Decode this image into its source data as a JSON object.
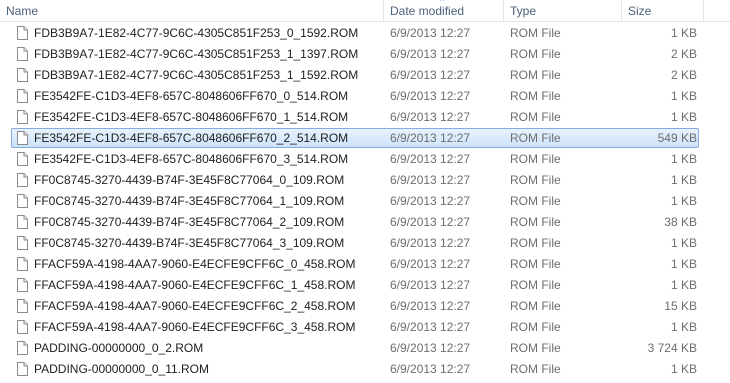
{
  "columns": {
    "name": "Name",
    "date": "Date modified",
    "type": "Type",
    "size": "Size"
  },
  "sort_arrow": "^",
  "rows": [
    {
      "name": "FDB3B9A7-1E82-4C77-9C6C-4305C851F253_0_1592.ROM",
      "date": "6/9/2013 12:27",
      "type": "ROM File",
      "size": "1 KB",
      "selected": false
    },
    {
      "name": "FDB3B9A7-1E82-4C77-9C6C-4305C851F253_1_1397.ROM",
      "date": "6/9/2013 12:27",
      "type": "ROM File",
      "size": "2 KB",
      "selected": false
    },
    {
      "name": "FDB3B9A7-1E82-4C77-9C6C-4305C851F253_1_1592.ROM",
      "date": "6/9/2013 12:27",
      "type": "ROM File",
      "size": "2 KB",
      "selected": false
    },
    {
      "name": "FE3542FE-C1D3-4EF8-657C-8048606FF670_0_514.ROM",
      "date": "6/9/2013 12:27",
      "type": "ROM File",
      "size": "1 KB",
      "selected": false
    },
    {
      "name": "FE3542FE-C1D3-4EF8-657C-8048606FF670_1_514.ROM",
      "date": "6/9/2013 12:27",
      "type": "ROM File",
      "size": "1 KB",
      "selected": false
    },
    {
      "name": "FE3542FE-C1D3-4EF8-657C-8048606FF670_2_514.ROM",
      "date": "6/9/2013 12:27",
      "type": "ROM File",
      "size": "549 KB",
      "selected": true
    },
    {
      "name": "FE3542FE-C1D3-4EF8-657C-8048606FF670_3_514.ROM",
      "date": "6/9/2013 12:27",
      "type": "ROM File",
      "size": "1 KB",
      "selected": false
    },
    {
      "name": "FF0C8745-3270-4439-B74F-3E45F8C77064_0_109.ROM",
      "date": "6/9/2013 12:27",
      "type": "ROM File",
      "size": "1 KB",
      "selected": false
    },
    {
      "name": "FF0C8745-3270-4439-B74F-3E45F8C77064_1_109.ROM",
      "date": "6/9/2013 12:27",
      "type": "ROM File",
      "size": "1 KB",
      "selected": false
    },
    {
      "name": "FF0C8745-3270-4439-B74F-3E45F8C77064_2_109.ROM",
      "date": "6/9/2013 12:27",
      "type": "ROM File",
      "size": "38 KB",
      "selected": false
    },
    {
      "name": "FF0C8745-3270-4439-B74F-3E45F8C77064_3_109.ROM",
      "date": "6/9/2013 12:27",
      "type": "ROM File",
      "size": "1 KB",
      "selected": false
    },
    {
      "name": "FFACF59A-4198-4AA7-9060-E4ECFE9CFF6C_0_458.ROM",
      "date": "6/9/2013 12:27",
      "type": "ROM File",
      "size": "1 KB",
      "selected": false
    },
    {
      "name": "FFACF59A-4198-4AA7-9060-E4ECFE9CFF6C_1_458.ROM",
      "date": "6/9/2013 12:27",
      "type": "ROM File",
      "size": "1 KB",
      "selected": false
    },
    {
      "name": "FFACF59A-4198-4AA7-9060-E4ECFE9CFF6C_2_458.ROM",
      "date": "6/9/2013 12:27",
      "type": "ROM File",
      "size": "15 KB",
      "selected": false
    },
    {
      "name": "FFACF59A-4198-4AA7-9060-E4ECFE9CFF6C_3_458.ROM",
      "date": "6/9/2013 12:27",
      "type": "ROM File",
      "size": "1 KB",
      "selected": false
    },
    {
      "name": "PADDING-00000000_0_2.ROM",
      "date": "6/9/2013 12:27",
      "type": "ROM File",
      "size": "3 724 KB",
      "selected": false
    },
    {
      "name": "PADDING-00000000_0_11.ROM",
      "date": "6/9/2013 12:27",
      "type": "ROM File",
      "size": "1 KB",
      "selected": false
    }
  ],
  "icons": {
    "file": "blank-file-icon"
  },
  "colors": {
    "header_text": "#4c607a",
    "selection_border": "#84acdd",
    "selection_fill": "#cde3fb",
    "secondary_text": "#6d6d6d"
  }
}
